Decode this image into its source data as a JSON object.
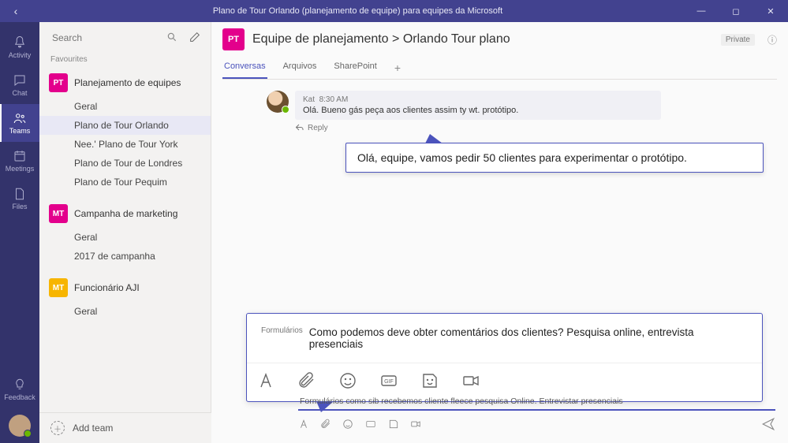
{
  "titlebar": {
    "title": "Plano de Tour Orlando (planejamento de equipe) para equipes da Microsoft"
  },
  "rail": {
    "activity": "Activity",
    "chat": "Chat",
    "teams": "Teams",
    "meetings": "Meetings",
    "files": "Files",
    "feedback": "Feedback"
  },
  "sidebar": {
    "search_placeholder": "Search",
    "favourites": "Favourites",
    "teams": [
      {
        "badge": "PT",
        "color": "#e3008c",
        "name": "Planejamento de equipes",
        "channels": [
          "Geral",
          "Plano de Tour Orlando",
          "Nee.' Plano de Tour York",
          "Plano de Tour de Londres",
          "Plano de Tour Pequim"
        ],
        "active_channel": 1
      },
      {
        "badge": "MT",
        "color": "#e3008c",
        "name": "Campanha de marketing",
        "channels": [
          "Geral",
          "2017 de campanha"
        ]
      },
      {
        "badge": "MT",
        "color": "#f7b500",
        "name": "Funcionário AJI",
        "channels": [
          "Geral"
        ]
      }
    ],
    "add_team": "Add team"
  },
  "header": {
    "badge": "PT",
    "breadcrumb": "Equipe de planejamento > Orlando Tour plano",
    "private": "Private"
  },
  "tabs": [
    "Conversas",
    "Arquivos",
    "SharePoint"
  ],
  "message": {
    "author": "Kat",
    "time": "8:30 AM",
    "text": "Olá. Bueno gás peça aos clientes assim ty wt. protótipo.",
    "reply": "Reply"
  },
  "callout1": "Olá, equipe, vamos pedir 50 clientes para experimentar o protótipo.",
  "compose_callout": {
    "label": "Formulários",
    "text": "Como podemos deve obter comentários dos clientes? Pesquisa online, entrevista presenciais"
  },
  "real_compose": {
    "text": "Formulários como sib recebemos cliente fleece pesquisa Online. Entrevistar presenciais"
  }
}
